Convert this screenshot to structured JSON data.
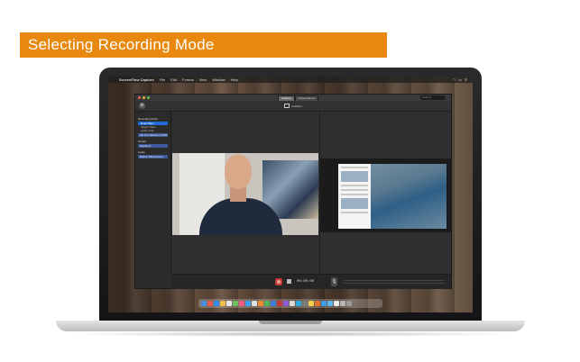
{
  "banner": {
    "title": "Selecting Recording Mode"
  },
  "menubar": {
    "apple": "",
    "app_name": "ScreenFlow Capture",
    "menus": [
      "File",
      "Edit",
      "Format",
      "View",
      "Window",
      "Help"
    ]
  },
  "window": {
    "segments": [
      "Capture",
      "Presentations"
    ],
    "search_placeholder": "Search",
    "layout_label": "Untitled 1"
  },
  "sidebar": {
    "recording_mode_header": "Recording Mode",
    "modes": [
      "Dual Video",
      "Single Video",
      "Audio Only"
    ],
    "mode_select": "HD Pro Webcam C920",
    "output_header": "Output",
    "output_select": "Display 2",
    "audio_header": "Audio",
    "audio_select": "Built-in Microphone"
  },
  "controls": {
    "timecode": "00:00:00"
  },
  "colors": {
    "banner": "#e8880e",
    "record": "#c23a33",
    "selection": "#1e6bd6"
  }
}
